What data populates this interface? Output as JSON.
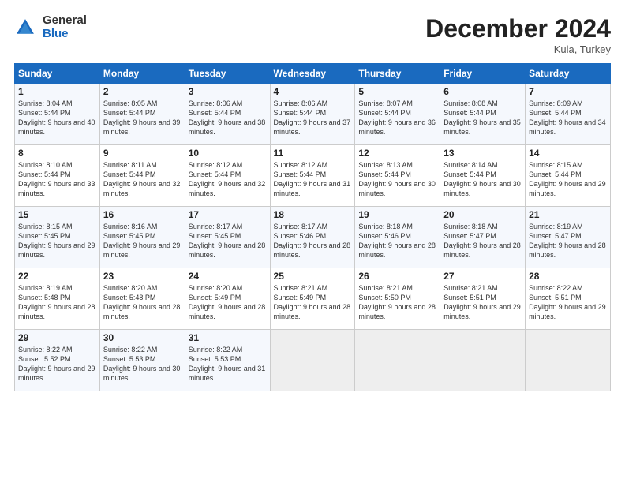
{
  "logo": {
    "general": "General",
    "blue": "Blue"
  },
  "header": {
    "title": "December 2024",
    "subtitle": "Kula, Turkey"
  },
  "days_of_week": [
    "Sunday",
    "Monday",
    "Tuesday",
    "Wednesday",
    "Thursday",
    "Friday",
    "Saturday"
  ],
  "weeks": [
    [
      {
        "day": "1",
        "sunrise": "8:04 AM",
        "sunset": "5:44 PM",
        "daylight": "9 hours and 40 minutes."
      },
      {
        "day": "2",
        "sunrise": "8:05 AM",
        "sunset": "5:44 PM",
        "daylight": "9 hours and 39 minutes."
      },
      {
        "day": "3",
        "sunrise": "8:06 AM",
        "sunset": "5:44 PM",
        "daylight": "9 hours and 38 minutes."
      },
      {
        "day": "4",
        "sunrise": "8:06 AM",
        "sunset": "5:44 PM",
        "daylight": "9 hours and 37 minutes."
      },
      {
        "day": "5",
        "sunrise": "8:07 AM",
        "sunset": "5:44 PM",
        "daylight": "9 hours and 36 minutes."
      },
      {
        "day": "6",
        "sunrise": "8:08 AM",
        "sunset": "5:44 PM",
        "daylight": "9 hours and 35 minutes."
      },
      {
        "day": "7",
        "sunrise": "8:09 AM",
        "sunset": "5:44 PM",
        "daylight": "9 hours and 34 minutes."
      }
    ],
    [
      {
        "day": "8",
        "sunrise": "8:10 AM",
        "sunset": "5:44 PM",
        "daylight": "9 hours and 33 minutes."
      },
      {
        "day": "9",
        "sunrise": "8:11 AM",
        "sunset": "5:44 PM",
        "daylight": "9 hours and 32 minutes."
      },
      {
        "day": "10",
        "sunrise": "8:12 AM",
        "sunset": "5:44 PM",
        "daylight": "9 hours and 32 minutes."
      },
      {
        "day": "11",
        "sunrise": "8:12 AM",
        "sunset": "5:44 PM",
        "daylight": "9 hours and 31 minutes."
      },
      {
        "day": "12",
        "sunrise": "8:13 AM",
        "sunset": "5:44 PM",
        "daylight": "9 hours and 30 minutes."
      },
      {
        "day": "13",
        "sunrise": "8:14 AM",
        "sunset": "5:44 PM",
        "daylight": "9 hours and 30 minutes."
      },
      {
        "day": "14",
        "sunrise": "8:15 AM",
        "sunset": "5:44 PM",
        "daylight": "9 hours and 29 minutes."
      }
    ],
    [
      {
        "day": "15",
        "sunrise": "8:15 AM",
        "sunset": "5:45 PM",
        "daylight": "9 hours and 29 minutes."
      },
      {
        "day": "16",
        "sunrise": "8:16 AM",
        "sunset": "5:45 PM",
        "daylight": "9 hours and 29 minutes."
      },
      {
        "day": "17",
        "sunrise": "8:17 AM",
        "sunset": "5:45 PM",
        "daylight": "9 hours and 28 minutes."
      },
      {
        "day": "18",
        "sunrise": "8:17 AM",
        "sunset": "5:46 PM",
        "daylight": "9 hours and 28 minutes."
      },
      {
        "day": "19",
        "sunrise": "8:18 AM",
        "sunset": "5:46 PM",
        "daylight": "9 hours and 28 minutes."
      },
      {
        "day": "20",
        "sunrise": "8:18 AM",
        "sunset": "5:47 PM",
        "daylight": "9 hours and 28 minutes."
      },
      {
        "day": "21",
        "sunrise": "8:19 AM",
        "sunset": "5:47 PM",
        "daylight": "9 hours and 28 minutes."
      }
    ],
    [
      {
        "day": "22",
        "sunrise": "8:19 AM",
        "sunset": "5:48 PM",
        "daylight": "9 hours and 28 minutes."
      },
      {
        "day": "23",
        "sunrise": "8:20 AM",
        "sunset": "5:48 PM",
        "daylight": "9 hours and 28 minutes."
      },
      {
        "day": "24",
        "sunrise": "8:20 AM",
        "sunset": "5:49 PM",
        "daylight": "9 hours and 28 minutes."
      },
      {
        "day": "25",
        "sunrise": "8:21 AM",
        "sunset": "5:49 PM",
        "daylight": "9 hours and 28 minutes."
      },
      {
        "day": "26",
        "sunrise": "8:21 AM",
        "sunset": "5:50 PM",
        "daylight": "9 hours and 28 minutes."
      },
      {
        "day": "27",
        "sunrise": "8:21 AM",
        "sunset": "5:51 PM",
        "daylight": "9 hours and 29 minutes."
      },
      {
        "day": "28",
        "sunrise": "8:22 AM",
        "sunset": "5:51 PM",
        "daylight": "9 hours and 29 minutes."
      }
    ],
    [
      {
        "day": "29",
        "sunrise": "8:22 AM",
        "sunset": "5:52 PM",
        "daylight": "9 hours and 29 minutes."
      },
      {
        "day": "30",
        "sunrise": "8:22 AM",
        "sunset": "5:53 PM",
        "daylight": "9 hours and 30 minutes."
      },
      {
        "day": "31",
        "sunrise": "8:22 AM",
        "sunset": "5:53 PM",
        "daylight": "9 hours and 31 minutes."
      },
      null,
      null,
      null,
      null
    ]
  ]
}
